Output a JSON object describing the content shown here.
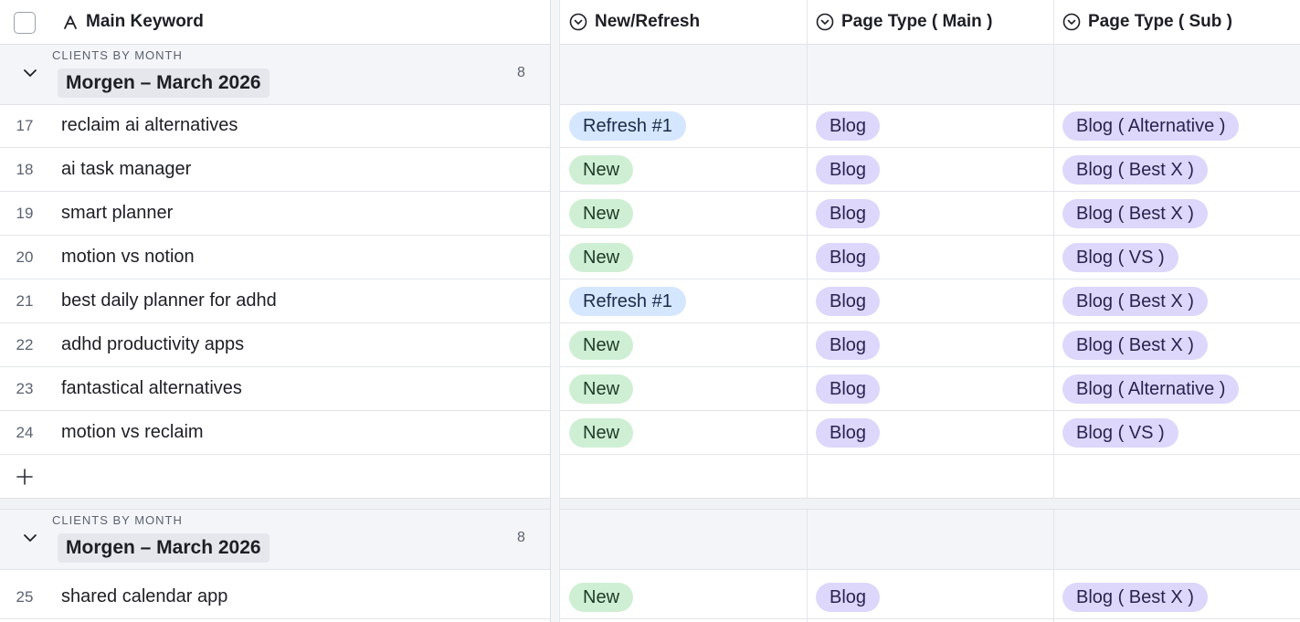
{
  "columns": {
    "main_keyword": "Main Keyword",
    "new_refresh": "New/Refresh",
    "page_type_main": "Page Type ( Main )",
    "page_type_sub": "Page Type ( Sub )"
  },
  "icons": {
    "sort": "sort-icon",
    "column_type": "circle-chevron-icon",
    "collapse": "chevron-down-icon",
    "add": "plus-icon"
  },
  "colors": {
    "new": "#cfefd4",
    "refresh": "#d5e6ff",
    "blog": "#ddd7fb"
  },
  "groups": [
    {
      "label": "CLIENTS BY MONTH",
      "name": "Morgen – March 2026",
      "count": "8",
      "rows": [
        {
          "num": "17",
          "keyword": "reclaim ai alternatives",
          "status": "Refresh #1",
          "status_kind": "blue",
          "main": "Blog",
          "sub": "Blog ( Alternative )"
        },
        {
          "num": "18",
          "keyword": "ai task manager",
          "status": "New",
          "status_kind": "green",
          "main": "Blog",
          "sub": "Blog ( Best X )"
        },
        {
          "num": "19",
          "keyword": "smart planner",
          "status": "New",
          "status_kind": "green",
          "main": "Blog",
          "sub": "Blog ( Best X )"
        },
        {
          "num": "20",
          "keyword": "motion vs notion",
          "status": "New",
          "status_kind": "green",
          "main": "Blog",
          "sub": "Blog ( VS )"
        },
        {
          "num": "21",
          "keyword": "best daily planner for adhd",
          "status": "Refresh #1",
          "status_kind": "blue",
          "main": "Blog",
          "sub": "Blog ( Best X )"
        },
        {
          "num": "22",
          "keyword": "adhd productivity apps",
          "status": "New",
          "status_kind": "green",
          "main": "Blog",
          "sub": "Blog ( Best X )"
        },
        {
          "num": "23",
          "keyword": "fantastical alternatives",
          "status": "New",
          "status_kind": "green",
          "main": "Blog",
          "sub": "Blog ( Alternative )"
        },
        {
          "num": "24",
          "keyword": "motion vs reclaim",
          "status": "New",
          "status_kind": "green",
          "main": "Blog",
          "sub": "Blog ( VS )"
        }
      ]
    },
    {
      "label": "CLIENTS BY MONTH",
      "name": "Morgen – March 2026",
      "count": "8",
      "rows": [
        {
          "num": "25",
          "keyword": "shared calendar app",
          "status": "New",
          "status_kind": "green",
          "main": "Blog",
          "sub": "Blog ( Best X )"
        }
      ]
    }
  ]
}
